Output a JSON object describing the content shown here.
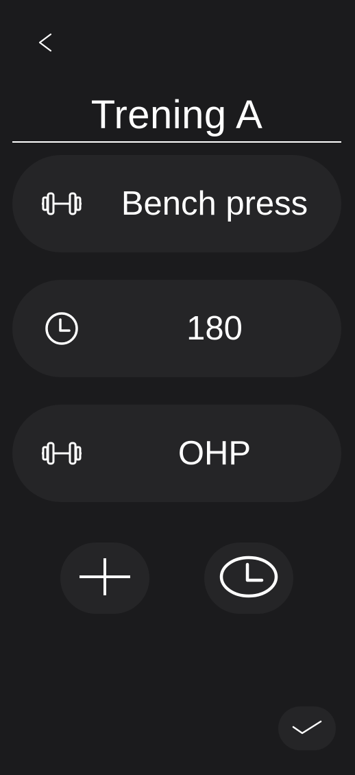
{
  "header": {
    "back_icon": "chevron-left-icon",
    "title": "Trening A"
  },
  "items": [
    {
      "type": "exercise",
      "icon": "dumbbell-icon",
      "label": "Bench press"
    },
    {
      "type": "rest",
      "icon": "clock-icon",
      "label": "180"
    },
    {
      "type": "exercise",
      "icon": "dumbbell-icon",
      "label": "OHP"
    }
  ],
  "actions": {
    "add_icon": "plus-icon",
    "add_rest_icon": "clock-icon",
    "confirm_icon": "checkmark-icon"
  },
  "colors": {
    "background": "#1b1b1d",
    "card": "#252527",
    "text": "#ffffff"
  }
}
